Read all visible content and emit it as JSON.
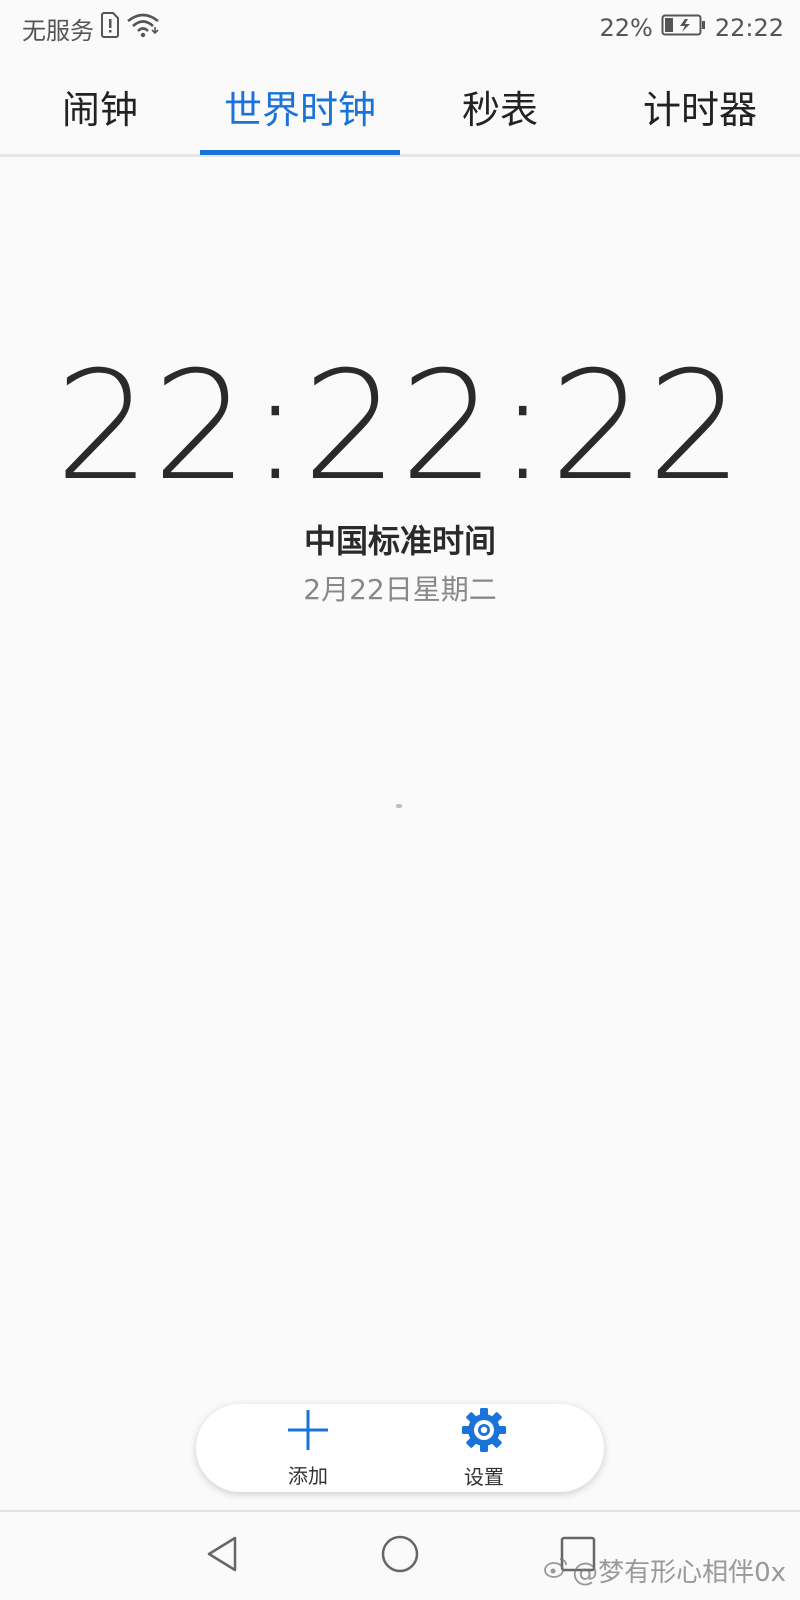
{
  "status_bar": {
    "carrier": "无服务",
    "battery_percent": "22%",
    "time": "22:22",
    "icons": [
      "sim-alert-icon",
      "wifi-icon",
      "battery-charging-icon"
    ]
  },
  "tabs": [
    {
      "label": "闹钟",
      "active": false
    },
    {
      "label": "世界时钟",
      "active": true
    },
    {
      "label": "秒表",
      "active": false
    },
    {
      "label": "计时器",
      "active": false
    }
  ],
  "clock": {
    "time": "22:22:22",
    "zone": "中国标准时间",
    "date": "2月22日星期二"
  },
  "actions": {
    "add_label": "添加",
    "settings_label": "设置"
  },
  "nav": {
    "icons": [
      "back-icon",
      "home-icon",
      "recents-icon"
    ]
  },
  "watermark": {
    "text": "@梦有形心相伴0x"
  },
  "colors": {
    "accent": "#1a73d9",
    "background": "#fafafa",
    "text": "#222222",
    "muted": "#888888"
  }
}
